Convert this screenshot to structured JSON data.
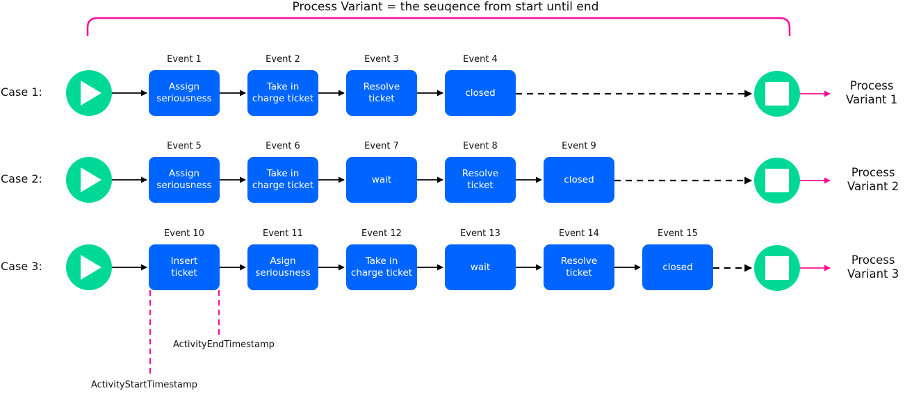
{
  "title": "Process Variant = the seuqence from start until end",
  "colors": {
    "box": "#0065ff",
    "circle": "#00d996",
    "accent": "#ff0a96",
    "arrow": "#000000"
  },
  "cases": [
    {
      "label": "Case 1:",
      "variant": "Process\nVariant 1",
      "events": [
        {
          "event": "Event 1",
          "activity": "Assign\nseriousness"
        },
        {
          "event": "Event 2",
          "activity": "Take in\ncharge ticket"
        },
        {
          "event": "Event 3",
          "activity": "Resolve\nticket"
        },
        {
          "event": "Event 4",
          "activity": "closed"
        }
      ]
    },
    {
      "label": "Case 2:",
      "variant": "Process\nVariant 2",
      "events": [
        {
          "event": "Event 5",
          "activity": "Assign\nseriousness"
        },
        {
          "event": "Event 6",
          "activity": "Take in\ncharge ticket"
        },
        {
          "event": "Event 7",
          "activity": "wait"
        },
        {
          "event": "Event 8",
          "activity": "Resolve\nticket"
        },
        {
          "event": "Event 9",
          "activity": "closed"
        }
      ]
    },
    {
      "label": "Case 3:",
      "variant": "Process\nVariant 3",
      "events": [
        {
          "event": "Event 10",
          "activity": "Insert\nticket"
        },
        {
          "event": "Event 11",
          "activity": "Asign\nseriousness"
        },
        {
          "event": "Event 12",
          "activity": "Take in\ncharge ticket"
        },
        {
          "event": "Event 13",
          "activity": "wait"
        },
        {
          "event": "Event 14",
          "activity": "Resolve\nticket"
        },
        {
          "event": "Event 15",
          "activity": "closed"
        }
      ]
    }
  ],
  "annotations": {
    "start_timestamp": "ActivityStartTimestamp",
    "end_timestamp": "ActivityEndTimestamp"
  }
}
